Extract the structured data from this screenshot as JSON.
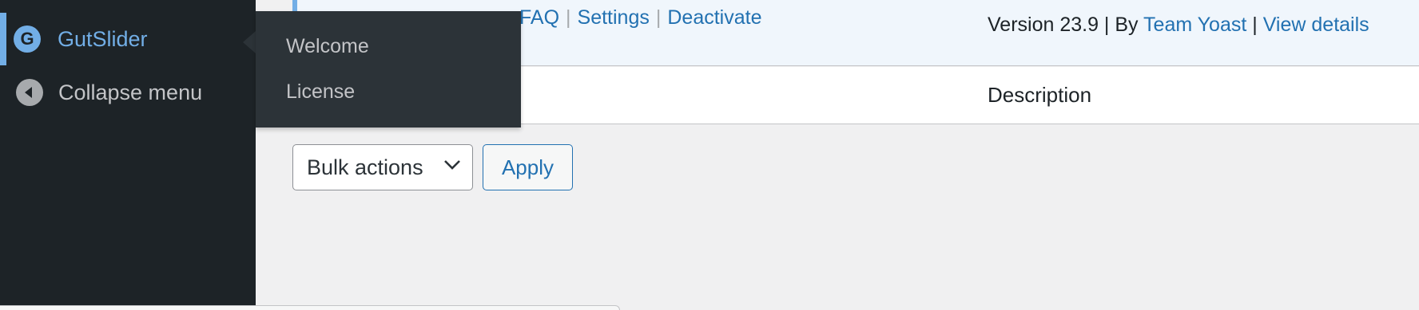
{
  "sidebar": {
    "current_item": {
      "label": "GutSlider",
      "icon": "gutslider-logo-icon"
    },
    "collapse_item": {
      "label": "Collapse menu",
      "icon": "collapse-arrow-icon"
    }
  },
  "flyout": {
    "items": [
      {
        "label": "Welcome"
      },
      {
        "label": "License"
      }
    ]
  },
  "plugin_row": {
    "actions": [
      "FAQ",
      "Settings",
      "Deactivate"
    ],
    "separator": "|",
    "version_text": "Version 23.9 | By ",
    "author": "Team Yoast",
    "meta_separator": " | ",
    "view_details": "View details"
  },
  "table_footer": {
    "description_header": "Description"
  },
  "bulk": {
    "select_value": "Bulk actions",
    "apply_label": "Apply"
  },
  "colors": {
    "link": "#2271b1",
    "sidebar_bg": "#1d2327",
    "flyout_bg": "#2c3338",
    "highlight": "#72aee6",
    "active_row_bg": "#f0f6fc"
  }
}
